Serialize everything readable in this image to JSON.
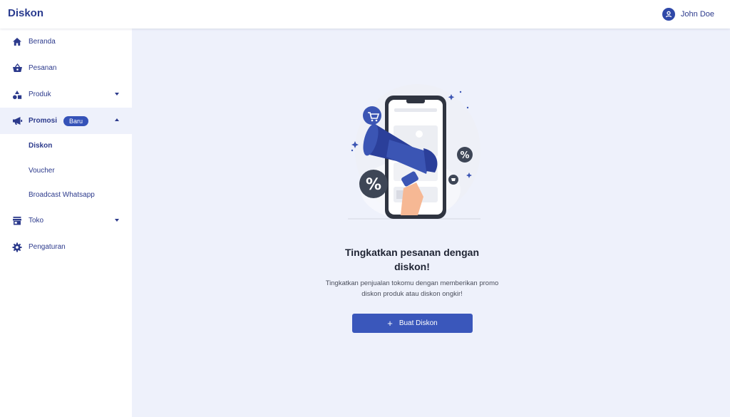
{
  "header": {
    "title": "Diskon",
    "user": {
      "name": "John Doe",
      "icon": "user-circle-icon"
    }
  },
  "sidebar": {
    "items": [
      {
        "label": "Beranda",
        "icon": "home-icon"
      },
      {
        "label": "Pesanan",
        "icon": "basket-icon"
      },
      {
        "label": "Produk",
        "icon": "shapes-icon",
        "expandable": true
      },
      {
        "label": "Promosi",
        "icon": "megaphone-icon",
        "badge": "Baru",
        "expanded": true
      },
      {
        "label": "Toko",
        "icon": "store-icon",
        "expandable": true
      },
      {
        "label": "Pengaturan",
        "icon": "gear-icon"
      }
    ],
    "promosi_sub": [
      {
        "label": "Diskon",
        "active": true
      },
      {
        "label": "Voucher"
      },
      {
        "label": "Broadcast Whatsapp"
      }
    ]
  },
  "main": {
    "empty_title_line1": "Tingkatkan pesanan dengan",
    "empty_title_line2": "diskon!",
    "empty_desc_line1": "Tingkatkan penjualan tokomu dengan memberikan promo",
    "empty_desc_line2": "diskon produk atau diskon ongkir!",
    "cta_label": "Buat Diskon"
  },
  "colors": {
    "accent": "#3a57bb",
    "nav_text": "#2c3a8c",
    "background": "#eef1fb"
  }
}
